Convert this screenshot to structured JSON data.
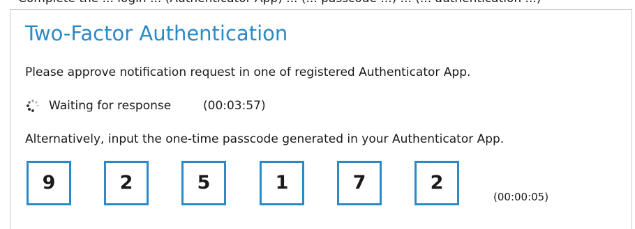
{
  "top_cut_text": "Complete the ... login ... (Authenticator App) ... (... passcode ...) ... (... authentication ...)",
  "panel": {
    "title": "Two-Factor Authentication",
    "approve_message": "Please approve notification request in one of registered Authenticator App.",
    "waiting": {
      "icon": "loading-spinner-icon",
      "label": "Waiting for response",
      "timer": "(00:03:57)"
    },
    "alternative_message": "Alternatively, input the one-time passcode generated in your Authenticator App.",
    "otp": {
      "digits": [
        "9",
        "2",
        "5",
        "1",
        "7",
        "2"
      ],
      "timer": "(00:00:05)"
    }
  },
  "colors": {
    "accent": "#2a8ac8",
    "text": "#1a1a1a",
    "border": "#c9c9c9"
  }
}
